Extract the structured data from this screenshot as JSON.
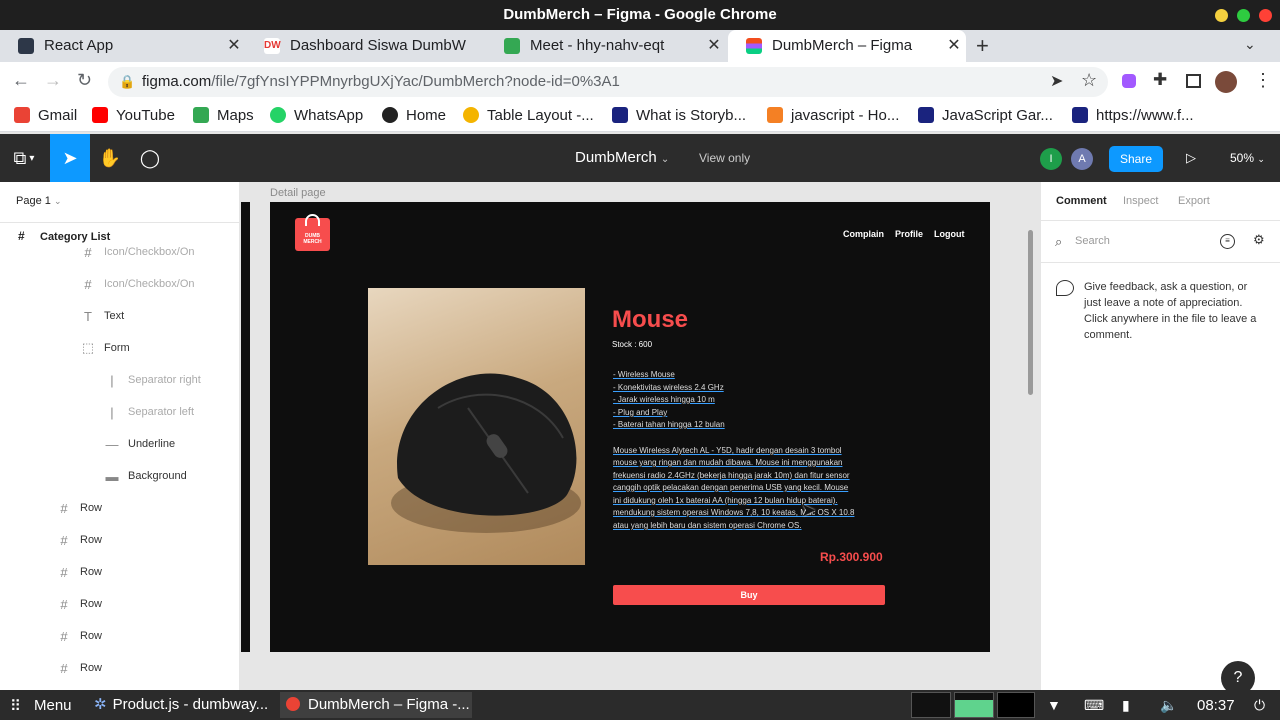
{
  "window": {
    "title": "DumbMerch – Figma - Google Chrome"
  },
  "tabs": [
    {
      "label": "React App",
      "favicon_color": "#2d3748"
    },
    {
      "label": "Dashboard Siswa DumbW",
      "favicon_color": "#e53935"
    },
    {
      "label": "Meet - hhy-nahv-eqt",
      "favicon_color": "#34a853"
    },
    {
      "label": "DumbMerch – Figma",
      "favicon_color": "#f24e1e"
    }
  ],
  "address": {
    "host": "figma.com",
    "path": "/file/7gfYnsIYPPMnyrbgUXjYac/DumbMerch?node-id=0%3A1"
  },
  "bookmarks": [
    {
      "label": "Gmail",
      "color": "#ea4335"
    },
    {
      "label": "YouTube",
      "color": "#ff0000"
    },
    {
      "label": "Maps",
      "color": "#34a853"
    },
    {
      "label": "WhatsApp",
      "color": "#25d366"
    },
    {
      "label": "Home",
      "color": "#222222"
    },
    {
      "label": "Table Layout -...",
      "color": "#f4b400"
    },
    {
      "label": "What is Storyb...",
      "color": "#1a237e"
    },
    {
      "label": "javascript - Ho...",
      "color": "#f48024"
    },
    {
      "label": "JavaScript Gar...",
      "color": "#1a237e"
    },
    {
      "label": "https://www.f...",
      "color": "#1a237e"
    }
  ],
  "figma": {
    "file_name": "DumbMerch",
    "view_mode": "View only",
    "share_label": "Share",
    "zoom": "50%",
    "avatars": [
      {
        "letter": "I",
        "color": "#1e9e4a"
      },
      {
        "letter": "A",
        "color": "#6f7ab0"
      }
    ]
  },
  "left_panel": {
    "page": "Page 1",
    "root": "Category List",
    "layers": [
      {
        "label": "Icon/Checkbox/On",
        "icon": "#",
        "dim": true,
        "indent": 88
      },
      {
        "label": "Icon/Checkbox/On",
        "icon": "#",
        "dim": true,
        "indent": 88
      },
      {
        "label": "Text",
        "icon": "T",
        "dim": false,
        "indent": 88
      },
      {
        "label": "Form",
        "icon": "⬚",
        "dim": false,
        "indent": 88
      },
      {
        "label": "Separator right",
        "icon": "|",
        "dim": true,
        "indent": 112
      },
      {
        "label": "Separator left",
        "icon": "|",
        "dim": true,
        "indent": 112
      },
      {
        "label": "Underline",
        "icon": "—",
        "dim": false,
        "indent": 112
      },
      {
        "label": "Background",
        "icon": "▬",
        "dim": false,
        "indent": 112
      },
      {
        "label": "Row",
        "icon": "#",
        "dim": false,
        "indent": 64
      },
      {
        "label": "Row",
        "icon": "#",
        "dim": false,
        "indent": 64
      },
      {
        "label": "Row",
        "icon": "#",
        "dim": false,
        "indent": 64
      },
      {
        "label": "Row",
        "icon": "#",
        "dim": false,
        "indent": 64
      },
      {
        "label": "Row",
        "icon": "#",
        "dim": false,
        "indent": 64
      },
      {
        "label": "Row",
        "icon": "#",
        "dim": false,
        "indent": 64
      }
    ]
  },
  "canvas": {
    "frame_label": "Detail page",
    "logo_text": "DUMB MERCH",
    "nav": [
      "Complain",
      "Profile",
      "Logout"
    ],
    "product": {
      "name": "Mouse",
      "stock": "Stock : 600",
      "features": [
        "- Wireless Mouse",
        "- Konektivitas wireless 2.4 GHz",
        "- Jarak wireless hingga 10 m",
        "- Plug and Play",
        "- Baterai tahan hingga 12 bulan"
      ],
      "description": [
        "Mouse Wireless Alytech AL - Y5D, hadir dengan desain 3 tombol",
        "mouse yang ringan dan mudah dibawa. Mouse ini menggunakan",
        "frekuensi radio 2.4GHz (bekerja hingga jarak 10m) dan fitur sensor",
        "canggih optik pelacakan dengan penerima USB yang kecil. Mouse",
        "ini didukung oleh 1x baterai AA (hingga 12 bulan hidup baterai).",
        "mendukung sistem operasi Windows 7,8, 10 keatas, Mac OS X 10.8",
        "atau yang lebih baru dan sistem operasi Chrome OS."
      ],
      "price": "Rp.300.900",
      "buy_label": "Buy"
    }
  },
  "right_panel": {
    "tabs": [
      "Comment",
      "Inspect",
      "Export"
    ],
    "search_placeholder": "Search",
    "hint": "Give feedback, ask a question, or just leave a note of appreciation. Click anywhere in the file to leave a comment."
  },
  "taskbar": {
    "menu_label": "Menu",
    "apps": [
      "Product.js - dumbway...",
      "DumbMerch – Figma -..."
    ],
    "time": "08:37"
  },
  "colors": {
    "accent_red": "#f74d4d",
    "figma_blue": "#0d99ff",
    "frame_bg": "#0e0e0e"
  }
}
